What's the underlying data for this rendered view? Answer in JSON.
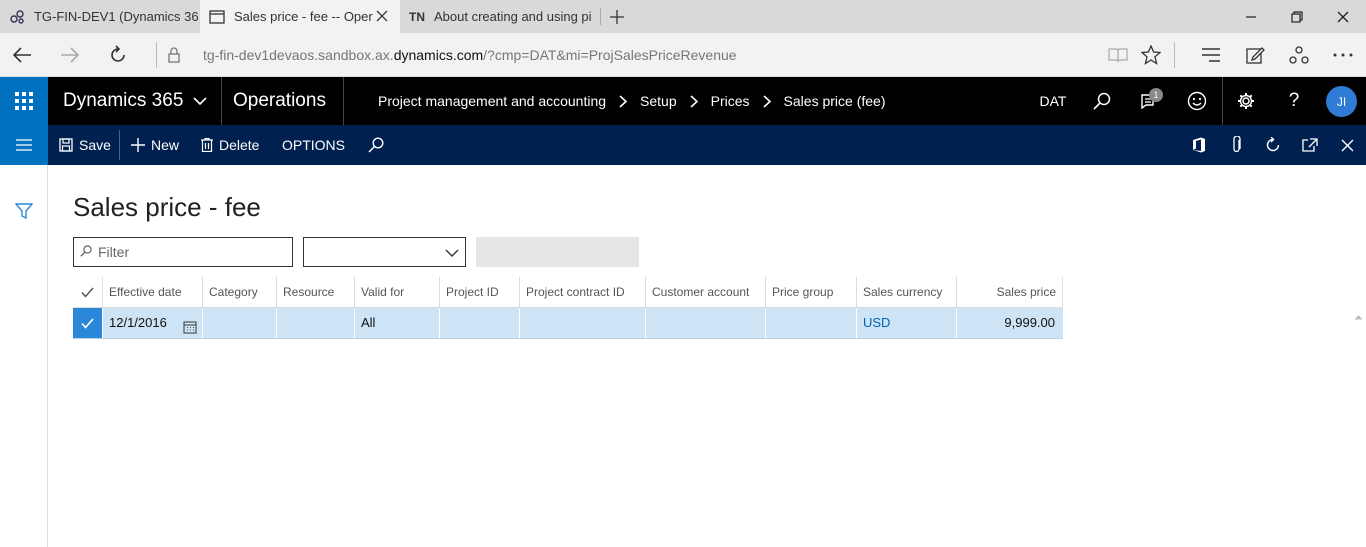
{
  "browser": {
    "tabs": [
      {
        "icon": "dynamics-icon",
        "label": "TG-FIN-DEV1 (Dynamics 36\u0003"
      },
      {
        "icon": "page-icon",
        "label": "Sales price - fee -- Oper"
      },
      {
        "icon": "TN",
        "label": "About creating and using pi"
      }
    ],
    "url_prefix": "tg-fin-dev1devaos.sandbox.ax.",
    "url_domain": "dynamics.com",
    "url_suffix": "/?cmp=DAT&mi=ProjSalesPriceRevenue"
  },
  "navbar": {
    "brand": "Dynamics 365",
    "module": "Operations",
    "breadcrumb": [
      "Project management and accounting",
      "Setup",
      "Prices",
      "Sales price (fee)"
    ],
    "company": "DAT",
    "notification_count": "1",
    "user_initials": "JI"
  },
  "actions": {
    "save": "Save",
    "new": "New",
    "delete": "Delete",
    "options": "OPTIONS"
  },
  "page": {
    "title": "Sales price - fee",
    "filter_placeholder": "Filter"
  },
  "grid": {
    "columns": [
      "Effective date",
      "Category",
      "Resource",
      "Valid for",
      "Project ID",
      "Project contract ID",
      "Customer account",
      "Price group",
      "Sales currency",
      "Sales price"
    ],
    "rows": [
      {
        "effective_date": "12/1/2016",
        "category": "",
        "resource": "",
        "valid_for": "All",
        "project_id": "",
        "project_contract_id": "",
        "customer_account": "",
        "price_group": "",
        "sales_currency": "USD",
        "sales_price": "9,999.00"
      }
    ]
  },
  "colors": {
    "accent": "#0070c0",
    "action_pane": "#002050",
    "selected_row": "#cce4f6",
    "link": "#0063b1"
  }
}
